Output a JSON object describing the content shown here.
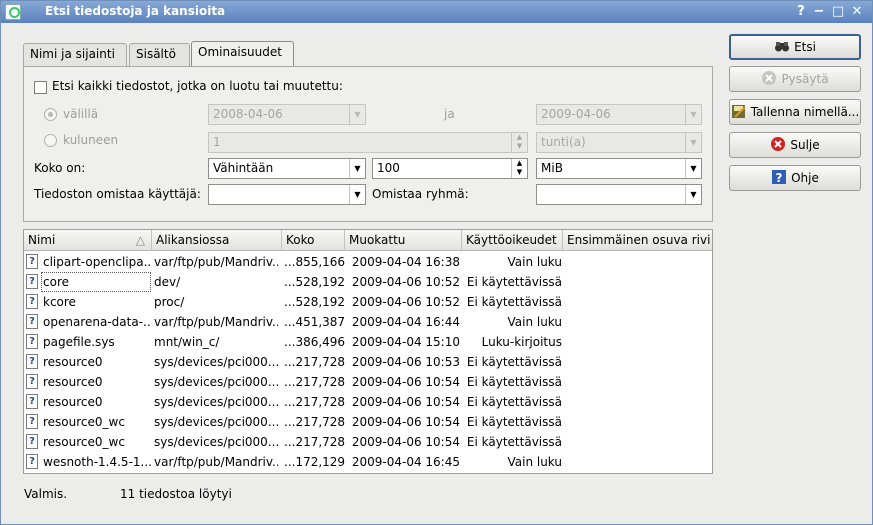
{
  "window": {
    "title": "Etsi tiedostoja ja kansioita",
    "help_glyph": "?",
    "minimize_glyph": "−",
    "maximize_glyph": "□",
    "close_glyph": "✕"
  },
  "tabs": [
    {
      "label": "Nimi ja sijainti"
    },
    {
      "label": "Sisältö"
    },
    {
      "label": "Ominaisuudet"
    }
  ],
  "properties": {
    "date_checkbox_label": "Etsi kaikki tiedostot, jotka on luotu tai muutettu:",
    "between_label": "välillä",
    "from_date": "2008-04-06",
    "and_label": "ja",
    "to_date": "2009-04-06",
    "elapsed_label": "kuluneen",
    "elapsed_value": "1",
    "elapsed_unit": "tunti(a)",
    "size_label": "Koko on:",
    "size_mode": "Vähintään",
    "size_value": "100",
    "size_unit": "MiB",
    "owner_label": "Tiedoston omistaa käyttäjä:",
    "owner_value": "",
    "group_label": "Omistaa ryhmä:",
    "group_value": ""
  },
  "buttons": {
    "search": "Etsi",
    "stop": "Pysäytä",
    "save_as": "Tallenna nimellä...",
    "close": "Sulje",
    "help": "Ohje"
  },
  "results": {
    "columns": [
      "Nimi",
      "Alikansiossa",
      "Koko",
      "Muokattu",
      "Käyttöoikeudet",
      "Ensimmäinen osuva rivi"
    ],
    "sort_indicator": "△",
    "rows": [
      {
        "name": "clipart-openclipa...",
        "folder": "var/ftp/pub/Mandriv...",
        "size": "...855,166",
        "modified": "2009-04-04 16:38",
        "perms": "Vain luku",
        "match": ""
      },
      {
        "name": "core",
        "folder": "dev/",
        "size": "...528,192",
        "modified": "2009-04-06 10:52",
        "perms": "Ei käytettävissä",
        "match": ""
      },
      {
        "name": "kcore",
        "folder": "proc/",
        "size": "...528,192",
        "modified": "2009-04-06 10:52",
        "perms": "Ei käytettävissä",
        "match": ""
      },
      {
        "name": "openarena-data-...",
        "folder": "var/ftp/pub/Mandriv...",
        "size": "...451,387",
        "modified": "2009-04-04 16:44",
        "perms": "Vain luku",
        "match": ""
      },
      {
        "name": "pagefile.sys",
        "folder": "mnt/win_c/",
        "size": "...386,496",
        "modified": "2009-04-04 15:10",
        "perms": "Luku-kirjoitus",
        "match": ""
      },
      {
        "name": "resource0",
        "folder": "sys/devices/pci000...",
        "size": "...217,728",
        "modified": "2009-04-06 10:53",
        "perms": "Ei käytettävissä",
        "match": ""
      },
      {
        "name": "resource0",
        "folder": "sys/devices/pci000...",
        "size": "...217,728",
        "modified": "2009-04-06 10:54",
        "perms": "Ei käytettävissä",
        "match": ""
      },
      {
        "name": "resource0",
        "folder": "sys/devices/pci000...",
        "size": "...217,728",
        "modified": "2009-04-06 10:54",
        "perms": "Ei käytettävissä",
        "match": ""
      },
      {
        "name": "resource0_wc",
        "folder": "sys/devices/pci000...",
        "size": "...217,728",
        "modified": "2009-04-06 10:54",
        "perms": "Ei käytettävissä",
        "match": ""
      },
      {
        "name": "resource0_wc",
        "folder": "sys/devices/pci000...",
        "size": "...217,728",
        "modified": "2009-04-06 10:54",
        "perms": "Ei käytettävissä",
        "match": ""
      },
      {
        "name": "wesnoth-1.4.5-1...",
        "folder": "var/ftp/pub/Mandriv...",
        "size": "...172,129",
        "modified": "2009-04-04 16:45",
        "perms": "Vain luku",
        "match": ""
      }
    ]
  },
  "status": {
    "state": "Valmis.",
    "count": "11 tiedostoa löytyi"
  }
}
